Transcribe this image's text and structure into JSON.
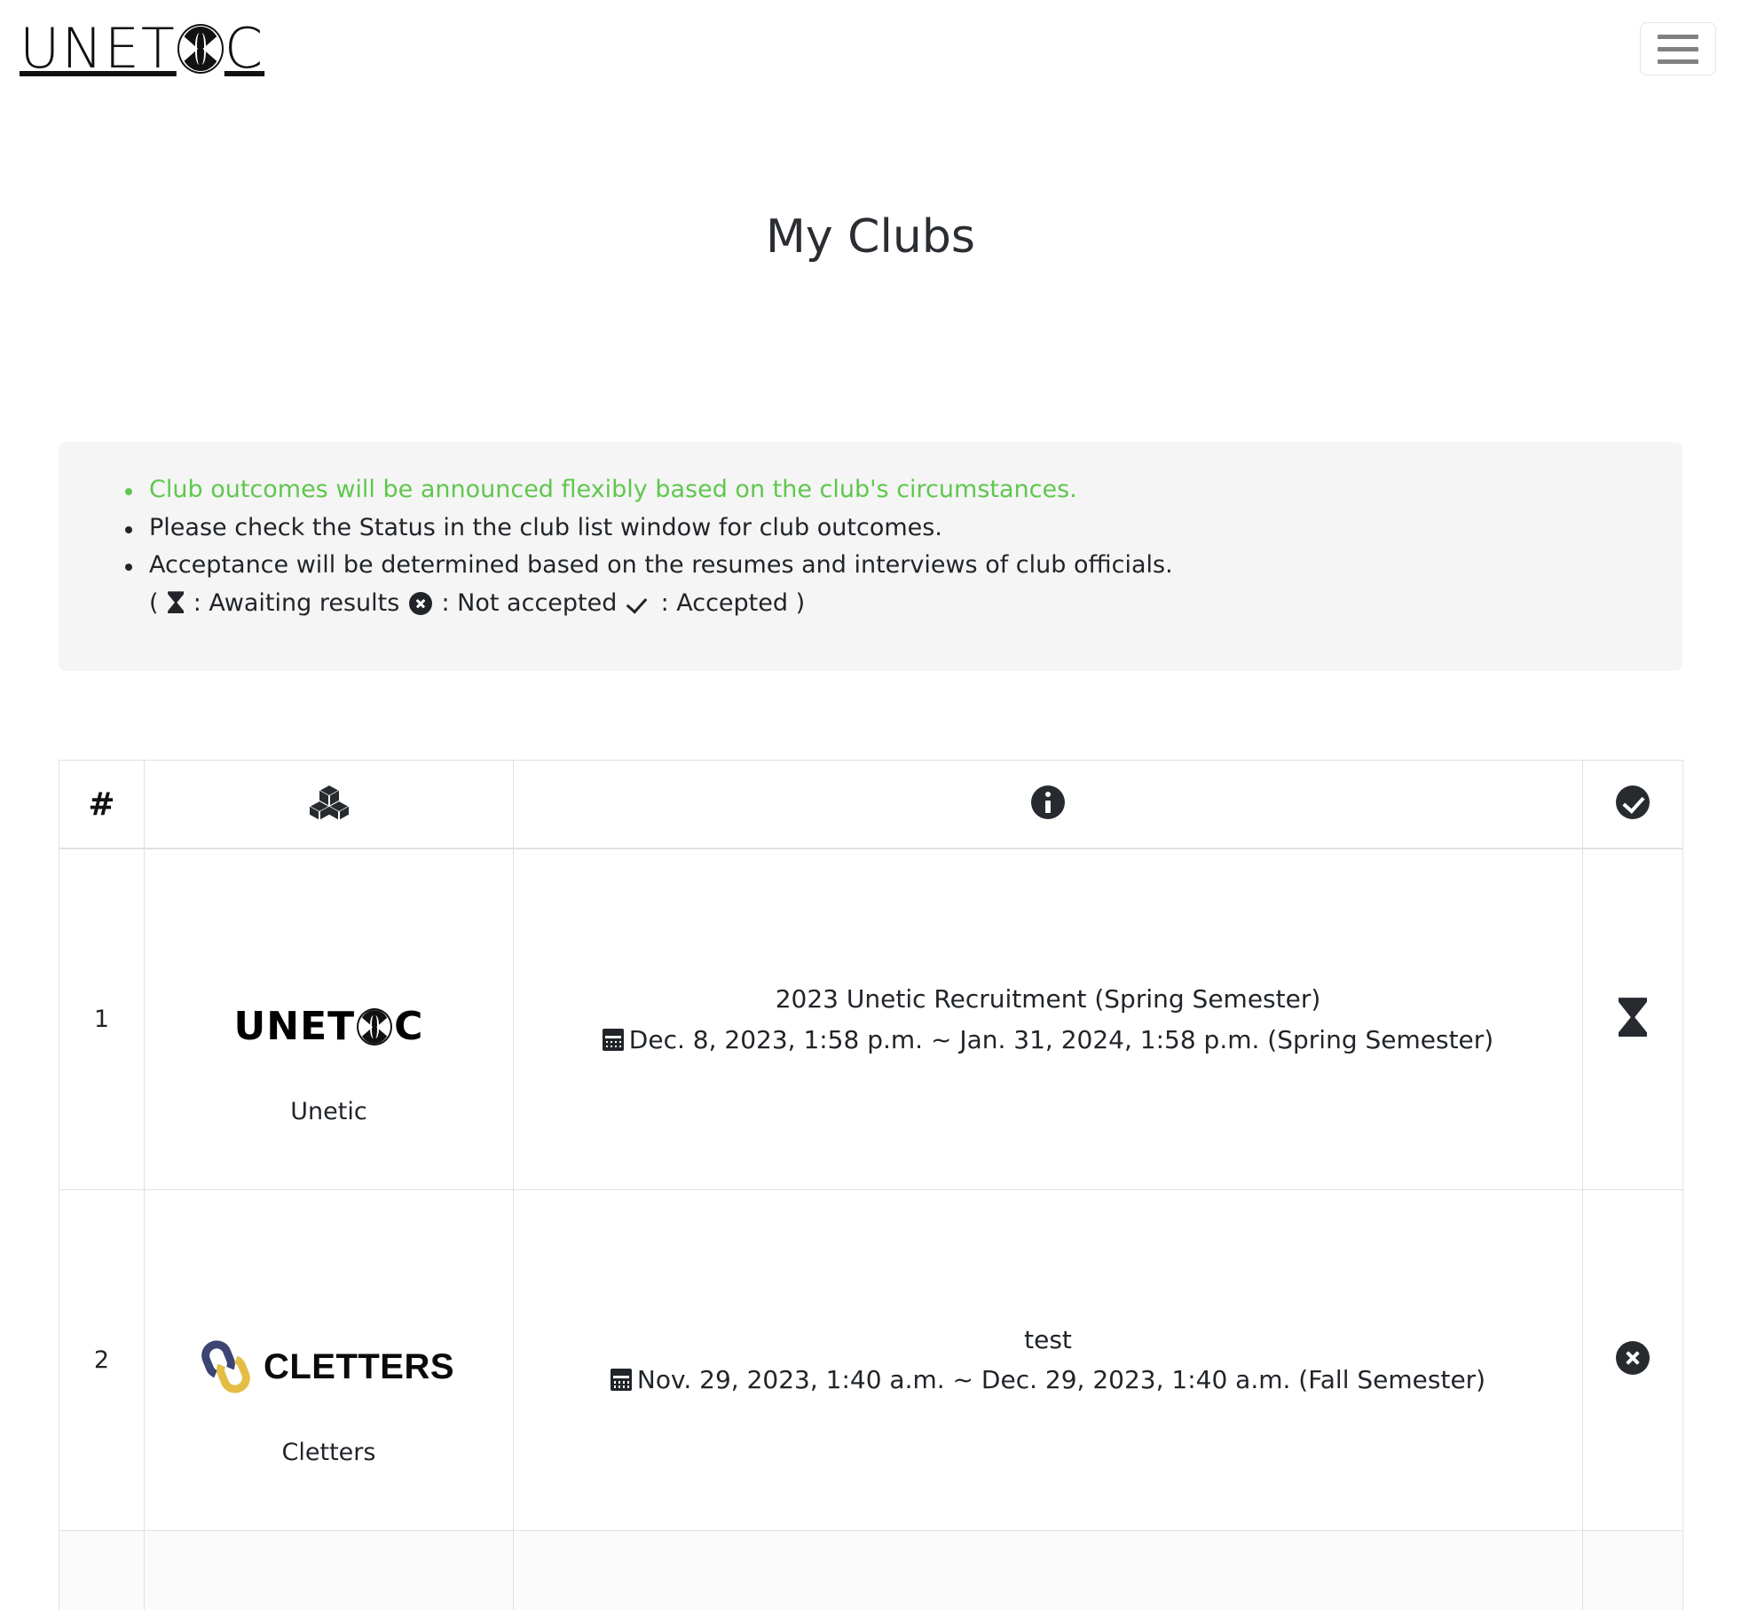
{
  "navbar": {
    "brand_left": "UNET",
    "brand_right": "C",
    "brand_icon": "hourglass-glyph",
    "toggler_label": "navbar-toggler"
  },
  "page": {
    "title": "My Clubs"
  },
  "notice": {
    "items": [
      "Club outcomes will be announced flexibly based on the club's circumstances.",
      "Please check the Status in the club list window for club outcomes.",
      "Acceptance will be determined based on the resumes and interviews of club officials."
    ],
    "legend": {
      "open_paren": "(",
      "awaiting_label": ": Awaiting results",
      "not_accepted_label": ": Not accepted",
      "accepted_label": ": Accepted",
      "close_paren": ")",
      "awaiting_icon": "hourglass-icon",
      "not_accepted_icon": "times-circle-icon",
      "accepted_icon": "check-icon"
    },
    "highlight_color": "#5fc74d",
    "background_color": "#f5f5f5"
  },
  "table": {
    "headers": [
      {
        "key": "num",
        "label": "#",
        "icon": null
      },
      {
        "key": "logo",
        "label": "",
        "icon": "cubes-icon"
      },
      {
        "key": "info",
        "label": "",
        "icon": "info-circle-icon"
      },
      {
        "key": "state",
        "label": "",
        "icon": "check-circle-icon"
      }
    ],
    "rows": [
      {
        "num": "1",
        "club_name": "Unetic",
        "logo_type": "unetic-logo",
        "logo_text_left": "UNET",
        "logo_text_right": "C",
        "title": "2023 Unetic Recruitment (Spring Semester)",
        "date": "Dec. 8, 2023, 1:58 p.m. ~ Jan. 31, 2024, 1:58 p.m. (Spring Semester)",
        "status_icon": "hourglass-icon",
        "status_label": "Awaiting results"
      },
      {
        "num": "2",
        "club_name": "Cletters",
        "logo_type": "cletters-logo",
        "logo_word": "CLETTERS",
        "logo_color_primary": "#3b4472",
        "logo_color_secondary": "#e4bd45",
        "title": "test",
        "date": "Nov. 29, 2023, 1:40 a.m. ~ Dec. 29, 2023, 1:40 a.m. (Fall Semester)",
        "status_icon": "times-circle-icon",
        "status_label": "Not accepted"
      }
    ]
  }
}
